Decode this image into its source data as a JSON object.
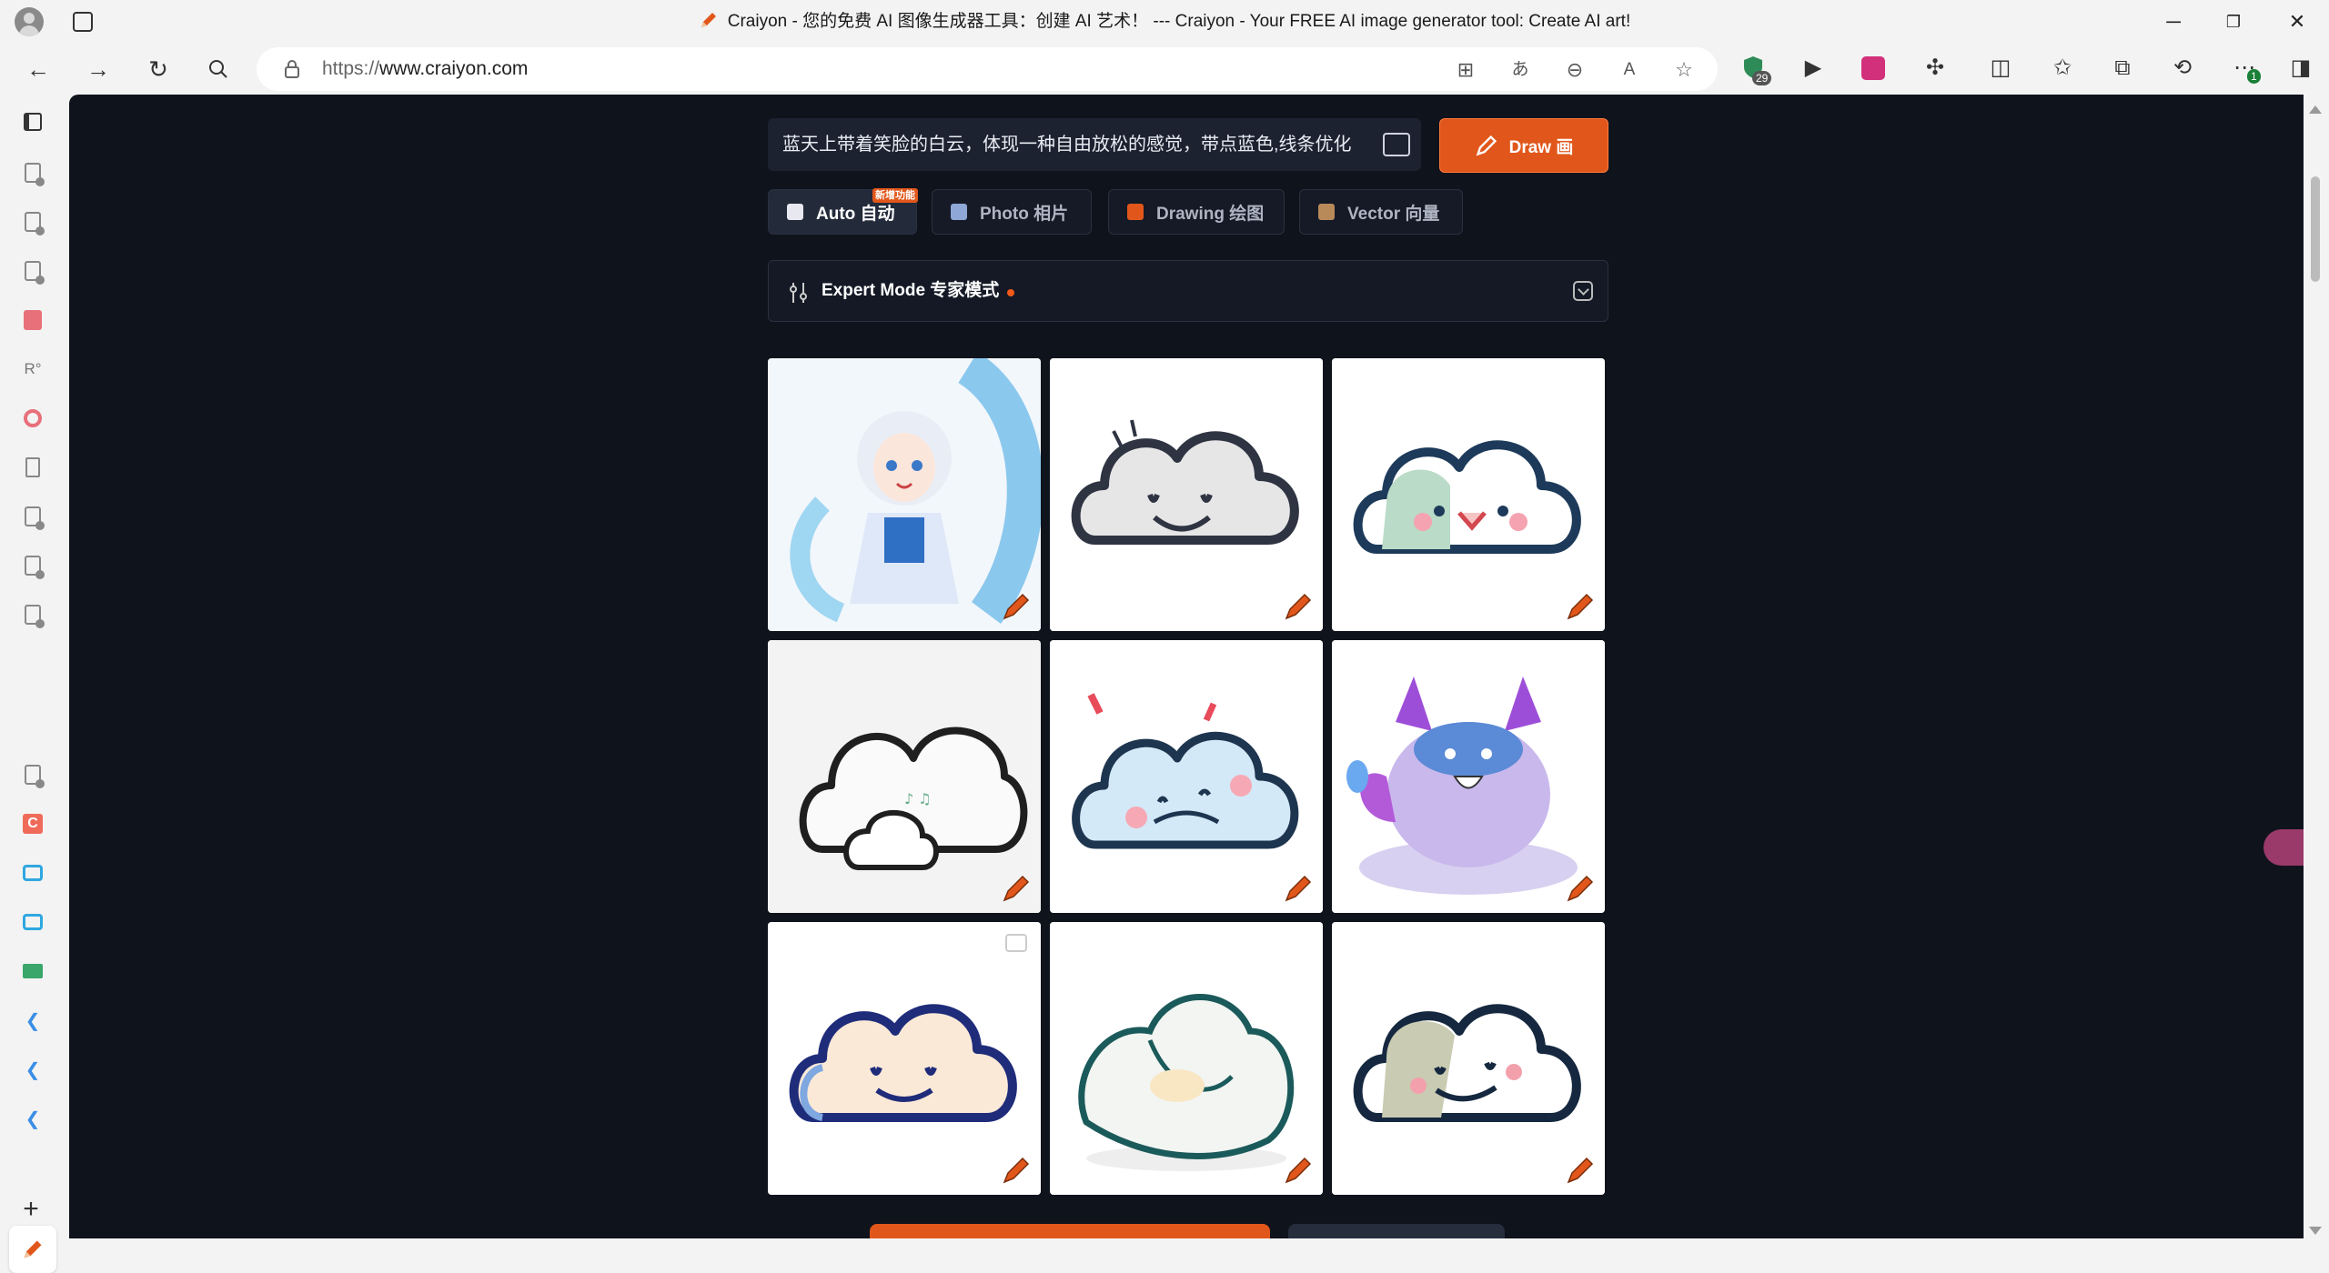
{
  "window": {
    "title": "Craiyon - 您的免费 AI 图像生成器工具：创建 AI 艺术！ --- Craiyon - Your FREE AI image generator tool: Create AI art!",
    "controls": {
      "minimize": "─",
      "restore": "❐",
      "close": "✕"
    }
  },
  "navbar": {
    "url_scheme": "https://",
    "url_host": "www.craiyon.com",
    "extensions_badge": "29",
    "more_badge": "1"
  },
  "page": {
    "prompt": "蓝天上带着笑脸的白云，体现一种自由放松的感觉，带点蓝色,线条优化",
    "draw_label": "Draw 画",
    "modes": [
      {
        "label": "Auto 自动",
        "badge": "新增功能"
      },
      {
        "label": "Photo 相片"
      },
      {
        "label": "Drawing 绘图"
      },
      {
        "label": "Vector 向量"
      }
    ],
    "expert_label": "Expert Mode 专家模式"
  },
  "colors": {
    "accent": "#e1571b",
    "page_bg": "#0f131c",
    "panel_bg": "#1d2231"
  }
}
